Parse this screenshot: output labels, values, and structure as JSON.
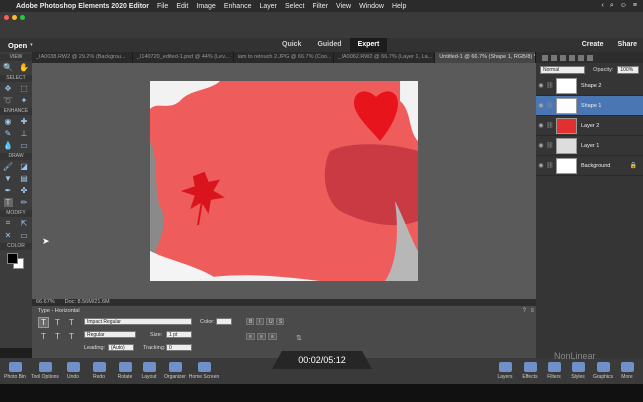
{
  "menubar": {
    "app_name": "Adobe Photoshop Elements 2020 Editor",
    "items": [
      "File",
      "Edit",
      "Image",
      "Enhance",
      "Layer",
      "Select",
      "Filter",
      "View",
      "Window",
      "Help"
    ]
  },
  "modebar": {
    "open_label": "Open",
    "modes": [
      "Quick",
      "Guided",
      "Expert"
    ],
    "create_label": "Create",
    "share_label": "Share"
  },
  "tabs": [
    "_IA0038.RW2 @ 29.2% (Backgrou...",
    "_I140720_edited-1.psd @ 44% (Lev...",
    "iam to retouch 2.JPG @ 66.7% (Coo...",
    "_IA0062.RW2 @ 66.7% (Layer 1, La...",
    "Untitled-1 @ 66.7% (Shape 1, RGB/8) *"
  ],
  "toolbox": {
    "sections": [
      "VIEW",
      "SELECT",
      "ENHANCE",
      "DRAW",
      "MODIFY",
      "COLOR"
    ]
  },
  "status": {
    "zoom": "66.67%",
    "doc": "Doc: 8.56M/21.6M"
  },
  "options": {
    "tool_name": "Type - Horizontal",
    "font": "Impact Regular",
    "style": "Regular",
    "size_label": "Size:",
    "size": "1 pt",
    "leading_label": "Leading:",
    "leading": "(Auto)",
    "tracking_label": "Tracking:",
    "tracking": "0",
    "color_label": "Color:",
    "bold_glyph": "B",
    "italic_glyph": "I",
    "underline_glyph": "U",
    "strike_glyph": "S"
  },
  "panel": {
    "blend_mode": "Normal",
    "opacity_label": "Opacity:",
    "opacity": "100%",
    "layers": [
      {
        "name": "Shape 2",
        "selected": false
      },
      {
        "name": "Shape 1",
        "selected": true
      },
      {
        "name": "Layer 2",
        "selected": false
      },
      {
        "name": "Layer 1",
        "selected": false
      },
      {
        "name": "Background",
        "selected": false
      }
    ]
  },
  "bottombar": {
    "left_tools": [
      "Photo Bin",
      "Tool Options",
      "Undo",
      "Redo",
      "Rotate",
      "Layout",
      "Organizer",
      "Home Screen"
    ],
    "right_tools": [
      "Layers",
      "Effects",
      "Filters",
      "Styles",
      "Graphics",
      "More"
    ]
  },
  "overlay": {
    "timecode": "00:02/05:12",
    "watermark": "NonLinear"
  },
  "colors": {
    "accent": "#4b76b4",
    "canvas_red": "#ef5c5c",
    "shape_red": "#e8141c"
  }
}
